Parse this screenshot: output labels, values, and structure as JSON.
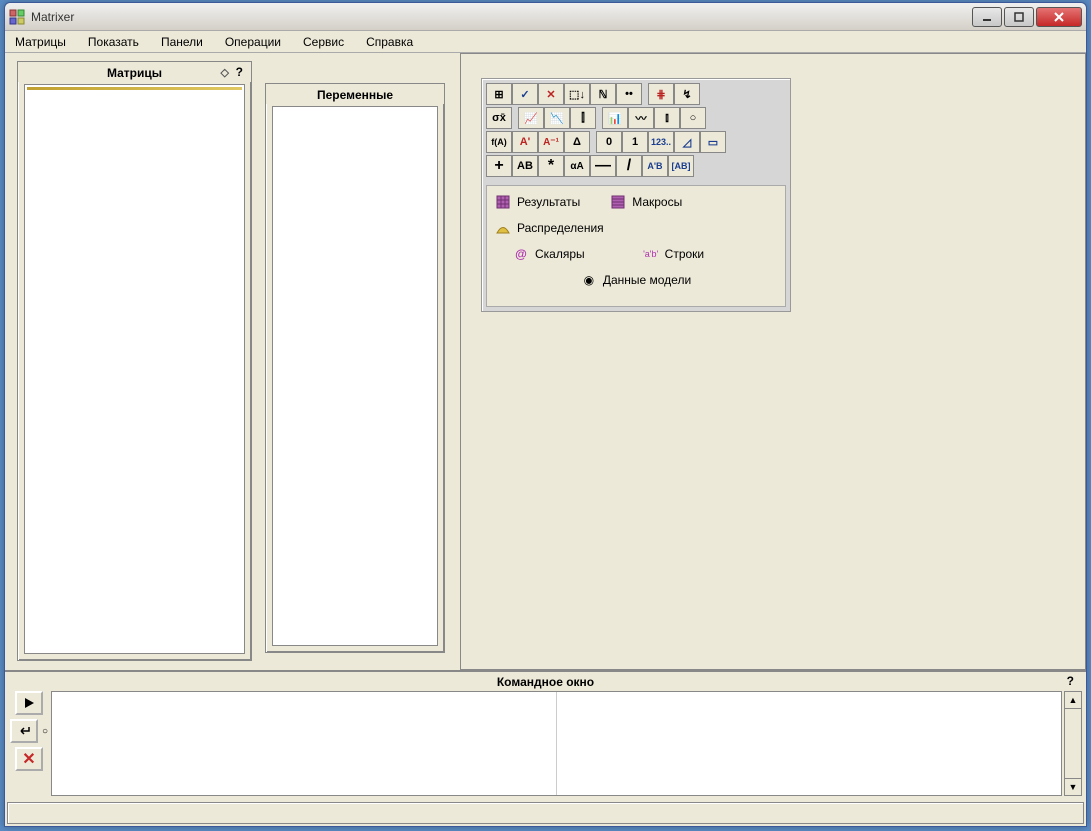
{
  "app": {
    "title": "Matrixer"
  },
  "menu": {
    "matrices": "Матрицы",
    "show": "Показать",
    "panels": "Панели",
    "operations": "Операции",
    "service": "Сервис",
    "help": "Справка"
  },
  "panels": {
    "matrices_title": "Матрицы",
    "vars_title": "Переменные",
    "help_symbol": "?",
    "pin_symbol": "◇"
  },
  "toolbox": {
    "row1": [
      "⊞",
      "✓",
      "✕",
      "⬚↓",
      "ℕ",
      "••",
      "⋕",
      "↯"
    ],
    "row2": [
      "σx̄",
      "📈",
      "📉",
      "⫿",
      "📊",
      "〰",
      "⫾",
      "○"
    ],
    "row3": [
      "f(A)",
      "A'",
      "A⁻¹",
      "Δ",
      "0",
      "1",
      "123..",
      "◿",
      "▭"
    ],
    "row4": [
      "+",
      "AB",
      "*",
      "αA",
      "—",
      "/",
      "A'B",
      "[AB]"
    ],
    "categories": {
      "results": "Результаты",
      "macros": "Макросы",
      "distributions": "Распределения",
      "scalars": "Скаляры",
      "strings": "Строки",
      "model_data": "Данные модели",
      "at_symbol": "@",
      "strings_icon": "'a'b'",
      "model_icon": "◉"
    }
  },
  "command": {
    "title": "Командное окно",
    "help_symbol": "?",
    "input_value": "",
    "output_value": "",
    "circle": "○"
  }
}
